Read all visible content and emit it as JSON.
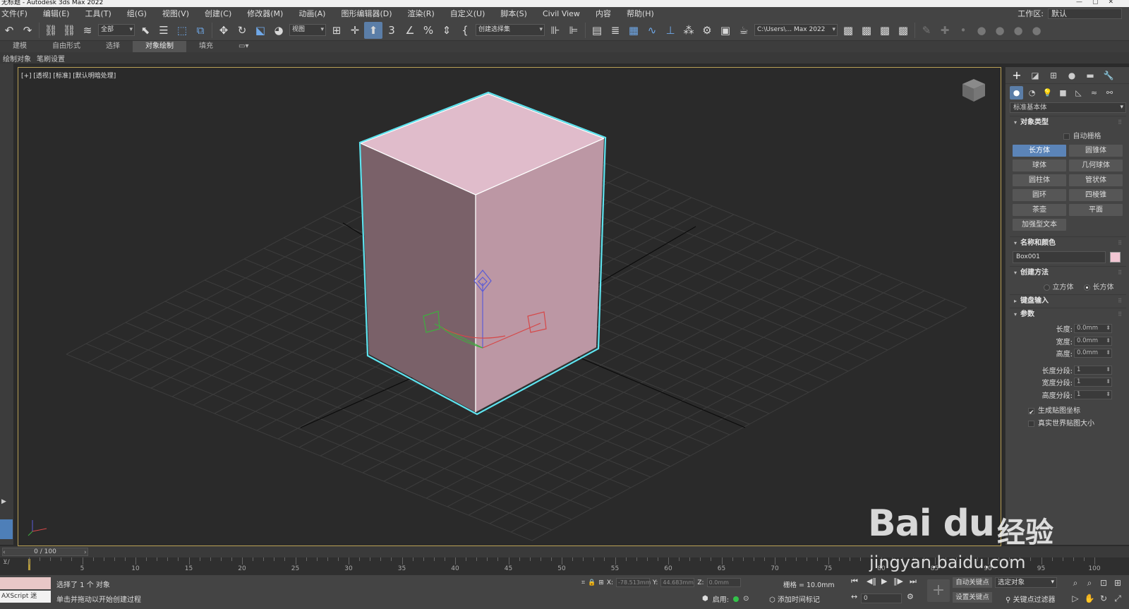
{
  "app": {
    "title": "无标题 - Autodesk 3ds Max 2022",
    "workspace_label": "工作区:",
    "workspace_value": "默认"
  },
  "menu": [
    "文件(F)",
    "编辑(E)",
    "工具(T)",
    "组(G)",
    "视图(V)",
    "创建(C)",
    "修改器(M)",
    "动画(A)",
    "图形编辑器(D)",
    "渲染(R)",
    "自定义(U)",
    "脚本(S)",
    "Civil View",
    "内容",
    "帮助(H)"
  ],
  "toolbar": {
    "selection_filter": "全部",
    "ref_coord": "视图",
    "named_selection": "创建选择集",
    "project_path": "C:\\Users\\... Max 2022"
  },
  "ribbon": {
    "tabs": [
      "建模",
      "自由形式",
      "选择",
      "对象绘制",
      "填充"
    ],
    "active_tab": "对象绘制",
    "sub_labels": [
      "绘制对象",
      "笔刷设置"
    ]
  },
  "viewport": {
    "label": "[+] [透视] [标准] [默认明暗处理]",
    "object_color": "#e0bccb",
    "selection_color": "#5ee3ef"
  },
  "command_panel": {
    "category": "标准基本体",
    "object_type": {
      "title": "对象类型",
      "autogrid": "自动栅格",
      "buttons": [
        "长方体",
        "圆锥体",
        "球体",
        "几何球体",
        "圆柱体",
        "管状体",
        "圆环",
        "四棱锥",
        "茶壶",
        "平面",
        "加强型文本"
      ],
      "active": "长方体"
    },
    "name_color": {
      "title": "名称和颜色",
      "name": "Box001",
      "color": "#f2c6d3"
    },
    "creation_method": {
      "title": "创建方法",
      "options": [
        "立方体",
        "长方体"
      ],
      "selected": "长方体"
    },
    "keyboard_entry": {
      "title": "键盘输入"
    },
    "parameters": {
      "title": "参数",
      "length_label": "长度:",
      "length": "0.0mm",
      "width_label": "宽度:",
      "width": "0.0mm",
      "height_label": "高度:",
      "height": "0.0mm",
      "length_segs_label": "长度分段:",
      "length_segs": "1",
      "width_segs_label": "宽度分段:",
      "width_segs": "1",
      "height_segs_label": "高度分段:",
      "height_segs": "1",
      "gen_mapping": "生成贴图坐标",
      "real_world": "真实世界贴图大小"
    }
  },
  "timeline": {
    "frame_display": "0 / 100",
    "ticks": [
      "5",
      "10",
      "15",
      "20",
      "25",
      "30",
      "35",
      "40",
      "45",
      "50",
      "55",
      "60",
      "65",
      "70",
      "75",
      "80",
      "85",
      "90",
      "95",
      "100"
    ],
    "track_label": "0"
  },
  "status": {
    "maxscript": "AXScript 迷",
    "line1": "选择了 1 个 对象",
    "line2": "单击并拖动以开始创建过程",
    "x_label": "X:",
    "x": "-78.513mm",
    "y_label": "Y:",
    "y": "44.683mm",
    "z_label": "Z:",
    "z": "0.0mm",
    "grid": "栅格 = 10.0mm",
    "enable": "启用:",
    "add_time_tag": "添加时间标记",
    "auto_key": "自动关键点",
    "set_key": "设置关键点",
    "selected_object": "选定对象",
    "key_filters": "关键点过滤器",
    "current_frame": "0"
  },
  "watermark": {
    "brand": "Bai du",
    "brand_cn": "经验",
    "url": "jingyan.baidu.com"
  }
}
